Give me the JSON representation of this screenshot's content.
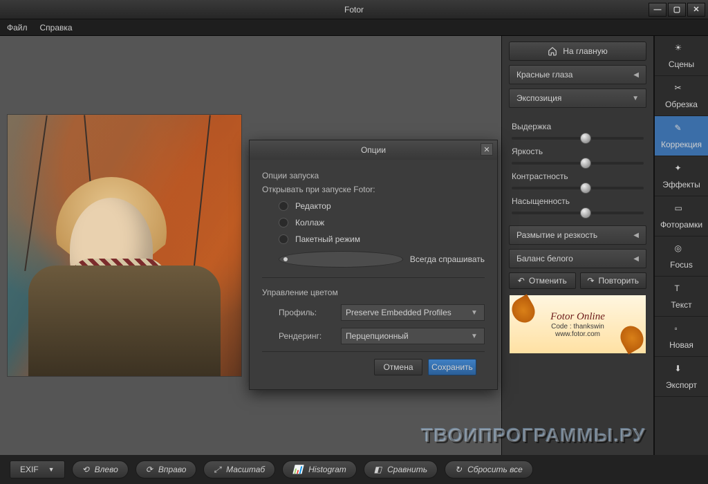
{
  "title": "Fotor",
  "menu": {
    "file": "Файл",
    "help": "Справка"
  },
  "home": "На главную",
  "accordions": {
    "redeye": "Красные глаза",
    "exposure": "Экспозиция",
    "blur": "Размытие и резкость",
    "wb": "Баланс белого"
  },
  "sliders": {
    "exposure": {
      "label": "Выдержка",
      "value": 52
    },
    "brightness": {
      "label": "Яркость",
      "value": 52
    },
    "contrast": {
      "label": "Контрастность",
      "value": 52
    },
    "saturation": {
      "label": "Насыщенность",
      "value": 52
    }
  },
  "undo": "Отменить",
  "redo": "Повторить",
  "promo": {
    "line1": "Fotor Online",
    "line2": "Code : thankswin",
    "line3": "www.fotor.com"
  },
  "vtabs": {
    "scenes": "Сцены",
    "crop": "Обрезка",
    "correction": "Коррекция",
    "effects": "Эффекты",
    "frames": "Фоторамки",
    "focus": "Focus",
    "text": "Текст",
    "new": "Новая",
    "export": "Экспорт"
  },
  "dialog": {
    "title": "Опции",
    "launchSection": "Опции запуска",
    "launchSub": "Открывать при запуске Fotor:",
    "opts": {
      "editor": "Редактор",
      "collage": "Коллаж",
      "batch": "Пакетный режим",
      "ask": "Всегда спрашивать"
    },
    "selected": "ask",
    "colorSection": "Управление цветом",
    "profileLabel": "Профиль:",
    "profileValue": "Preserve Embedded Profiles",
    "renderingLabel": "Рендеринг:",
    "renderingValue": "Перцепционный",
    "cancel": "Отмена",
    "save": "Сохранить"
  },
  "footer": {
    "exif": "EXIF",
    "left": "Влево",
    "right": "Вправо",
    "scale": "Масштаб",
    "histogram": "Histogram",
    "compare": "Сравнить",
    "reset": "Сбросить все"
  },
  "watermark": "ТВОИПРОГРАММЫ.РУ"
}
